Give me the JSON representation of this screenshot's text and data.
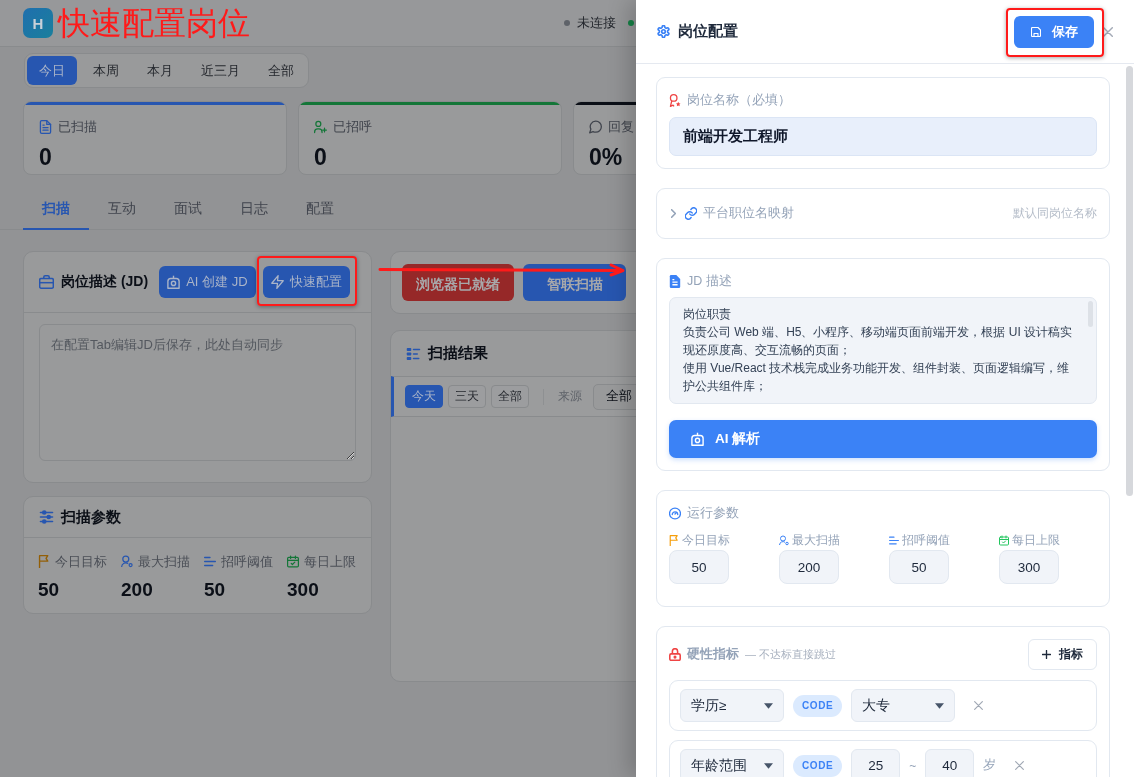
{
  "annotation": {
    "title": "快速配置岗位"
  },
  "header": {
    "logo": "H",
    "statuses": [
      {
        "label": "未连接",
        "color": "#5e6269"
      },
      {
        "color": "#158246"
      }
    ]
  },
  "periods": [
    {
      "label": "今日",
      "selected": true
    },
    {
      "label": "本周",
      "selected": false
    },
    {
      "label": "本月",
      "selected": false
    },
    {
      "label": "近三月",
      "selected": false
    },
    {
      "label": "全部",
      "selected": false
    }
  ],
  "stats": [
    {
      "label": "已扫描",
      "value": "0",
      "color": "#2756b0"
    },
    {
      "label": "已招呼",
      "value": "0",
      "color": "#147638"
    },
    {
      "label": "回复",
      "value": "0%",
      "color": "#0b0f17"
    }
  ],
  "tabs": [
    {
      "label": "扫描",
      "selected": true
    },
    {
      "label": "互动",
      "selected": false
    },
    {
      "label": "面试",
      "selected": false
    },
    {
      "label": "日志",
      "selected": false
    },
    {
      "label": "配置",
      "selected": false
    }
  ],
  "jd_card": {
    "title": "岗位描述 (JD)",
    "buttons": [
      {
        "label": "AI 创建 JD",
        "highlighted": false
      },
      {
        "label": "快速配置",
        "highlighted": true
      }
    ],
    "placeholder": "在配置Tab编辑JD后保存，此处自动同步"
  },
  "scan_params": {
    "title": "扫描参数",
    "items": [
      {
        "label": "今日目标",
        "value": "50"
      },
      {
        "label": "最大扫描",
        "value": "200"
      },
      {
        "label": "招呼阈值",
        "value": "50"
      },
      {
        "label": "每日上限",
        "value": "300"
      }
    ]
  },
  "actions": [
    {
      "label": "浏览器已就绪",
      "color": "#962828"
    },
    {
      "label": "智联扫描",
      "color": "#2756b0"
    }
  ],
  "results": {
    "title": "扫描结果",
    "ranges": [
      {
        "label": "今天",
        "selected": true
      },
      {
        "label": "三天",
        "selected": false
      },
      {
        "label": "全部",
        "selected": false
      }
    ],
    "source": {
      "label": "来源",
      "value": "全部"
    }
  },
  "drawer": {
    "title": "岗位配置",
    "save": {
      "label": "保存",
      "highlighted": true
    },
    "name_section": {
      "label": "岗位名称（必填）",
      "value": "前端开发工程师"
    },
    "mapping": {
      "label": "平台职位名映射",
      "hint": "默认同岗位名称",
      "expanded": false
    },
    "jd": {
      "label": "JD 描述",
      "paragraphs": [
        "岗位职责",
        "负责公司 Web 端、H5、小程序、移动端页面前端开发，根据 UI 设计稿实现还原度高、交互流畅的页面；",
        "使用 Vue/React 技术栈完成业务功能开发、组件封装、页面逻辑编写，维护公共组件库；"
      ],
      "button": "AI 解析"
    },
    "run_params": {
      "label": "运行参数",
      "items": [
        {
          "label": "今日目标",
          "value": "50"
        },
        {
          "label": "最大扫描",
          "value": "200"
        },
        {
          "label": "招呼阈值",
          "value": "50"
        },
        {
          "label": "每日上限",
          "value": "300"
        }
      ]
    },
    "criteria": {
      "label": "硬性指标",
      "note": "— 不达标直接跳过",
      "add_button": "指标",
      "rows": [
        {
          "kind": "select",
          "field": "学历≥",
          "tag": "CODE",
          "value": "大专"
        },
        {
          "kind": "range",
          "field": "年龄范围",
          "tag": "CODE",
          "min": "25",
          "separator": "~",
          "max": "40",
          "unit": "岁"
        }
      ]
    }
  }
}
